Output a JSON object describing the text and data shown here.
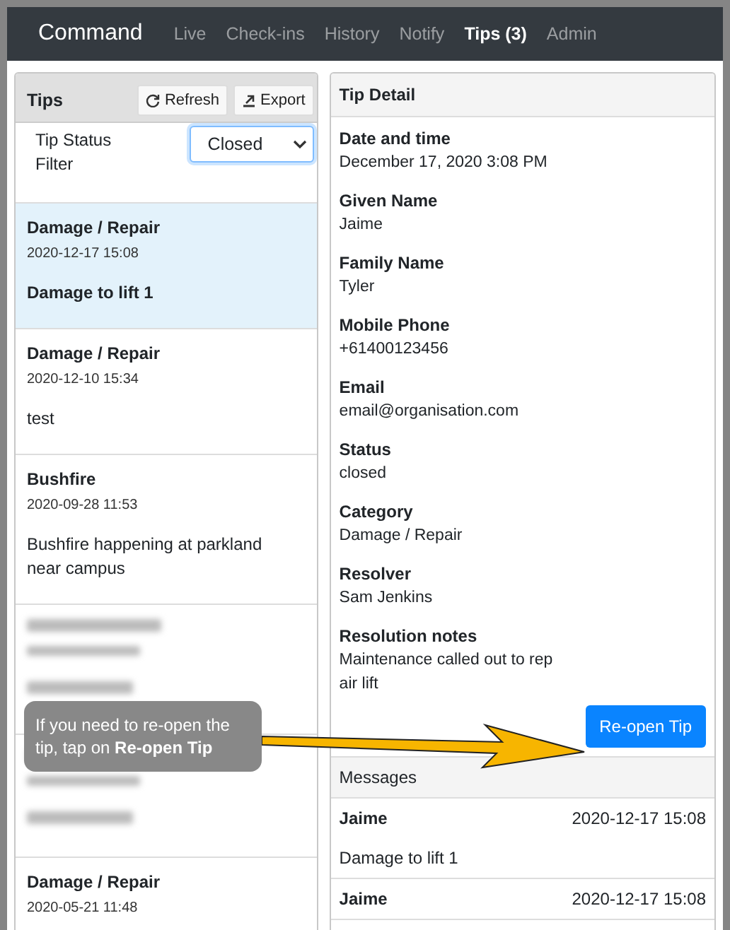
{
  "navbar": {
    "brand": "Command",
    "links": [
      {
        "label": "Live",
        "selected": false
      },
      {
        "label": "Check-ins",
        "selected": false
      },
      {
        "label": "History",
        "selected": false
      },
      {
        "label": "Notify",
        "selected": false
      },
      {
        "label": "Tips (3)",
        "selected": true
      },
      {
        "label": "Admin",
        "selected": false
      }
    ]
  },
  "tips_panel": {
    "title": "Tips",
    "buttons": [
      {
        "label": "Refresh",
        "kind": "refresh"
      },
      {
        "label": "Export",
        "kind": "export"
      }
    ],
    "filter_label": "Tip Status Filter",
    "filter_value": "Closed",
    "items": [
      {
        "kind": "text",
        "selected": true,
        "category": "Damage / Repair",
        "time": "2020-12-17 15:08",
        "summary": "Damage to lift 1"
      },
      {
        "kind": "text",
        "selected": false,
        "category": "Damage / Repair",
        "time": "2020-12-10 15:34",
        "summary": "test"
      },
      {
        "kind": "text",
        "selected": false,
        "category": "Bushfire",
        "time": "2020-09-28 11:53",
        "summary": "Bushfire happening at parkland near campus"
      },
      {
        "kind": "blurred",
        "selected": false
      },
      {
        "kind": "blurred",
        "selected": false
      },
      {
        "kind": "text",
        "selected": false,
        "category": "Damage / Repair",
        "time": "2020-05-21 11:48"
      }
    ]
  },
  "detail_panel": {
    "title": "Tip Detail",
    "fields": [
      {
        "label": "Date and time",
        "value": "December 17, 2020 3:08 PM"
      },
      {
        "label": "Given Name",
        "value": "Jaime"
      },
      {
        "label": "Family Name",
        "value": "Tyler"
      },
      {
        "label": "Mobile Phone",
        "value": "+61400123456"
      },
      {
        "label": "Email",
        "value": "email@organisation.com"
      },
      {
        "label": "Status",
        "value": "closed"
      },
      {
        "label": "Category",
        "value": "Damage / Repair"
      },
      {
        "label": "Resolver",
        "value": "Sam Jenkins"
      },
      {
        "label": "Resolution notes",
        "value": "Maintenance called out to rep air lift"
      }
    ],
    "action": "Re-open Tip",
    "messages_title": "Messages",
    "messages": [
      {
        "author": "Jaime",
        "time": "2020-12-17 15:08",
        "text": "Damage to lift 1"
      },
      {
        "author": "Jaime",
        "time": "2020-12-17 15:08"
      }
    ]
  },
  "callout": "If you need to re-open the tip, tap on **Re-open Tip**"
}
